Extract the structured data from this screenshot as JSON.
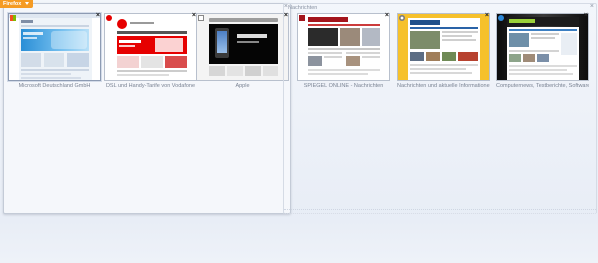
{
  "badge": {
    "label": "Firefox"
  },
  "groups": [
    {
      "title": "",
      "close": "×",
      "tiles": [
        {
          "label": "Microsoft Deutschland GmbH",
          "close": "×",
          "favicon": "microsoft-icon"
        },
        {
          "label": "DSL und Handy-Tarife von Vodafone",
          "close": "×",
          "favicon": "vodafone-icon"
        },
        {
          "label": "Apple",
          "close": "×",
          "favicon": "apple-icon"
        }
      ]
    },
    {
      "title": "Nachrichten",
      "close": "×",
      "tiles": [
        {
          "label": "SPIEGEL ONLINE - Nachrichten",
          "close": "×",
          "favicon": "spiegel-icon"
        },
        {
          "label": "Nachrichten und aktuelle Informationen",
          "close": "×",
          "favicon": "news-icon"
        },
        {
          "label": "Computernews, Testberichte, Software",
          "close": "×",
          "favicon": "computer-news-icon"
        }
      ]
    }
  ],
  "colors": {
    "badge": "#f59b24",
    "vodafone_red": "#e60000",
    "yellow_site": "#f6c12b"
  }
}
